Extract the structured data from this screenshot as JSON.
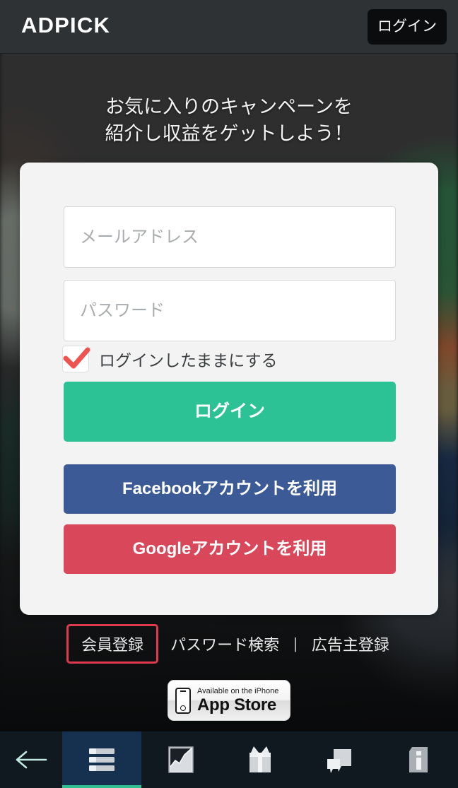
{
  "header": {
    "logo": "ADPICK",
    "login_label": "ログイン",
    "bg_color": "#2f3234",
    "login_bg_color": "#0b0c0d"
  },
  "tagline": {
    "line1": "お気に入りのキャンペーンを",
    "line2": "紹介し収益をゲットしよう！"
  },
  "login_form": {
    "email_placeholder": "メールアドレス",
    "email_value": "",
    "password_placeholder": "パスワード",
    "password_value": "",
    "remember_label": "ログインしたままにする",
    "remember_checked": true,
    "checkmark_color": "#ef5350",
    "submit_label": "ログイン",
    "submit_color": "#2dc295",
    "facebook_label": "Facebookアカウントを利用",
    "facebook_color": "#3b5a96",
    "google_label": "Googleアカウントを利用",
    "google_color": "#d9485a",
    "card_bg_color": "#f3f3f3"
  },
  "links": {
    "register": "会員登録",
    "password_search": "パスワード検索",
    "separator": "|",
    "advertiser_register": "広告主登録",
    "highlight_color": "#e03a4e"
  },
  "appstore_badge": {
    "line1": "Available on the iPhone",
    "line2": "App Store",
    "icon": "iphone-icon"
  },
  "bottom_nav": {
    "bg_color": "#101820",
    "active_bg_color": "#16304f",
    "active_underline_color": "#31c08f",
    "back_icon": "arrow-left-icon",
    "back_icon_color": "#bfe9e0",
    "items": [
      {
        "icon": "list-icon",
        "active": true
      },
      {
        "icon": "chart-icon",
        "active": false
      },
      {
        "icon": "gift-icon",
        "active": false
      },
      {
        "icon": "chat-icon",
        "active": false
      },
      {
        "icon": "info-icon",
        "active": false
      }
    ]
  }
}
